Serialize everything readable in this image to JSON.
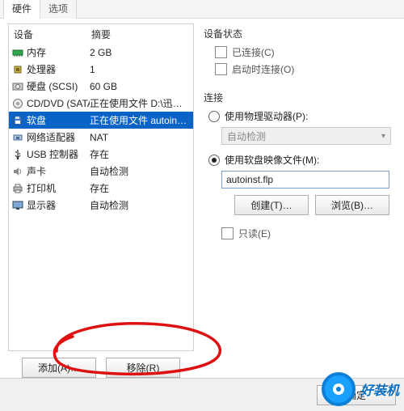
{
  "tabs": {
    "hardware": "硬件",
    "options": "选项"
  },
  "device_header": {
    "device": "设备",
    "summary": "摘要"
  },
  "devices": [
    {
      "icon": "memory-icon",
      "name": "内存",
      "summary": "2 GB"
    },
    {
      "icon": "cpu-icon",
      "name": "处理器",
      "summary": "1"
    },
    {
      "icon": "hdd-icon",
      "name": "硬盘 (SCSI)",
      "summary": "60 GB"
    },
    {
      "icon": "cd-icon",
      "name": "CD/DVD (SATA)",
      "summary": "正在使用文件 D:\\迅雷下载\\c..."
    },
    {
      "icon": "floppy-icon",
      "name": "软盘",
      "summary": "正在使用文件 autoinst.flp"
    },
    {
      "icon": "nic-icon",
      "name": "网络适配器",
      "summary": "NAT"
    },
    {
      "icon": "usb-icon",
      "name": "USB 控制器",
      "summary": "存在"
    },
    {
      "icon": "sound-icon",
      "name": "声卡",
      "summary": "自动检测"
    },
    {
      "icon": "printer-icon",
      "name": "打印机",
      "summary": "存在"
    },
    {
      "icon": "display-icon",
      "name": "显示器",
      "summary": "自动检测"
    }
  ],
  "selected_index": 4,
  "buttons": {
    "add": "添加(A)…",
    "remove": "移除(R)",
    "create": "创建(T)…",
    "browse": "浏览(B)…",
    "ok": "确定"
  },
  "status": {
    "title": "设备状态",
    "connected": "已连接(C)",
    "connect_at_power": "启动时连接(O)"
  },
  "connection": {
    "title": "连接",
    "use_physical": "使用物理驱动器(P):",
    "physical_combo": "自动检测",
    "use_image": "使用软盘映像文件(M):",
    "image_path": "autoinst.flp",
    "readonly": "只读(E)"
  },
  "watermark": "好装机"
}
